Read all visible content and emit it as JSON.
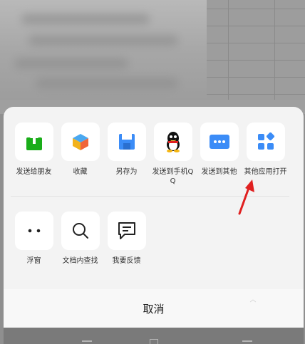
{
  "share_sheet": {
    "row1": [
      {
        "label": "发送给朋友",
        "icon": "upload-icon"
      },
      {
        "label": "收藏",
        "icon": "cube-icon"
      },
      {
        "label": "另存为",
        "icon": "floppy-disk-icon"
      },
      {
        "label": "发送到手机QQ",
        "icon": "qq-penguin-icon"
      },
      {
        "label": "发送到其他",
        "icon": "more-dots-icon"
      },
      {
        "label": "其他应用打开",
        "icon": "apps-grid-icon"
      }
    ],
    "row2": [
      {
        "label": "浮窗",
        "icon": "two-dots-icon"
      },
      {
        "label": "文档内查找",
        "icon": "search-icon"
      },
      {
        "label": "我要反馈",
        "icon": "message-box-icon"
      }
    ],
    "cancel_label": "取消"
  },
  "colors": {
    "green": "#1aad19",
    "blue": "#3b8cf7",
    "arrow_red": "#e02020"
  }
}
